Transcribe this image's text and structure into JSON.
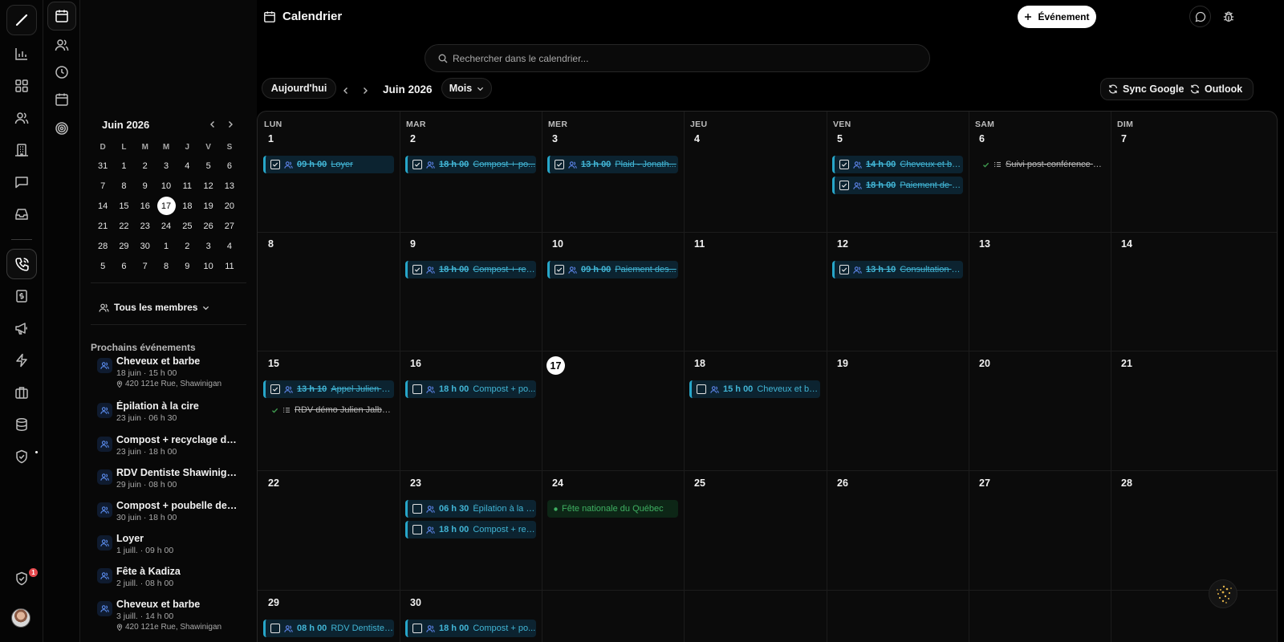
{
  "header": {
    "title": "Calendrier",
    "new_event": "Événement"
  },
  "search": {
    "placeholder": "Rechercher dans le calendrier..."
  },
  "toolbar": {
    "today": "Aujourd'hui",
    "month_label": "Juin 2026",
    "view": "Mois",
    "sync_google": "Sync Google",
    "sync_outlook": "Outlook"
  },
  "notifications": {
    "count": "1"
  },
  "mini_calendar": {
    "title": "Juin 2026",
    "dow": [
      "D",
      "L",
      "M",
      "M",
      "J",
      "V",
      "S"
    ],
    "days": [
      "31",
      "1",
      "2",
      "3",
      "4",
      "5",
      "6",
      "7",
      "8",
      "9",
      "10",
      "11",
      "12",
      "13",
      "14",
      "15",
      "16",
      "17",
      "18",
      "19",
      "20",
      "21",
      "22",
      "23",
      "24",
      "25",
      "26",
      "27",
      "28",
      "29",
      "30",
      "1",
      "2",
      "3",
      "4",
      "5",
      "6",
      "7",
      "8",
      "9",
      "10",
      "11"
    ],
    "today": "17"
  },
  "members_filter": "Tous les membres",
  "upcoming": {
    "title": "Prochains événements",
    "items": [
      {
        "title": "Cheveux et barbe",
        "when": "18 juin · 15 h 00",
        "location": "420 121e Rue, Shawinigan"
      },
      {
        "title": "Épilation à la cire",
        "when": "23 juin · 06 h 30"
      },
      {
        "title": "Compost + recyclage dem...",
        "when": "23 juin · 18 h 00"
      },
      {
        "title": "RDV Dentiste Shawinigan",
        "when": "29 juin · 08 h 00"
      },
      {
        "title": "Compost + poubelle dem...",
        "when": "30 juin · 18 h 00"
      },
      {
        "title": "Loyer",
        "when": "1 juill. · 09 h 00"
      },
      {
        "title": "Fête à Kadiza",
        "when": "2 juill. · 08 h 00"
      },
      {
        "title": "Cheveux et barbe",
        "when": "3 juill. · 14 h 00",
        "location": "420 121e Rue, Shawinigan"
      }
    ]
  },
  "weekdays": [
    "LUN",
    "MAR",
    "MER",
    "JEU",
    "VEN",
    "SAM",
    "DIM"
  ],
  "weeks": [
    [
      "1",
      "2",
      "3",
      "4",
      "5",
      "6",
      "7"
    ],
    [
      "8",
      "9",
      "10",
      "11",
      "12",
      "13",
      "14"
    ],
    [
      "15",
      "16",
      "17",
      "18",
      "19",
      "20",
      "21"
    ],
    [
      "22",
      "23",
      "24",
      "25",
      "26",
      "27",
      "28"
    ],
    [
      "29",
      "30",
      "",
      "",
      "",
      "",
      ""
    ]
  ],
  "today": "17",
  "events": [
    {
      "week": 0,
      "day": 0,
      "slot": 0,
      "kind": "done",
      "time": "09 h 00",
      "text": "Loyer"
    },
    {
      "week": 0,
      "day": 1,
      "slot": 0,
      "kind": "done",
      "time": "18 h 00",
      "text": "Compost + po..."
    },
    {
      "week": 0,
      "day": 2,
      "slot": 0,
      "kind": "done",
      "time": "13 h 00",
      "text": "Plaid - Jonath..."
    },
    {
      "week": 0,
      "day": 4,
      "slot": 0,
      "kind": "done",
      "time": "14 h 00",
      "text": "Cheveux et bar..."
    },
    {
      "week": 0,
      "day": 4,
      "slot": 1,
      "kind": "done",
      "time": "18 h 00",
      "text": "Paiement de G..."
    },
    {
      "week": 0,
      "day": 5,
      "slot": 0,
      "kind": "task",
      "time": "",
      "text": "Suivi post-conférence d..."
    },
    {
      "week": 1,
      "day": 1,
      "slot": 0,
      "kind": "done",
      "time": "18 h 00",
      "text": "Compost + rec..."
    },
    {
      "week": 1,
      "day": 2,
      "slot": 0,
      "kind": "done",
      "time": "09 h 00",
      "text": "Paiement des..."
    },
    {
      "week": 1,
      "day": 4,
      "slot": 0,
      "kind": "done",
      "time": "13 h 10",
      "text": "Consultation St..."
    },
    {
      "week": 2,
      "day": 0,
      "slot": 0,
      "kind": "done",
      "time": "13 h 10",
      "text": "Appel Julien Jal..."
    },
    {
      "week": 2,
      "day": 0,
      "slot": 1,
      "kind": "task",
      "time": "",
      "text": "RDV démo Julien Jalber..."
    },
    {
      "week": 2,
      "day": 1,
      "slot": 0,
      "kind": "open",
      "time": "18 h 00",
      "text": "Compost + po..."
    },
    {
      "week": 2,
      "day": 3,
      "slot": 0,
      "kind": "open",
      "time": "15 h 00",
      "text": "Cheveux et bar..."
    },
    {
      "week": 3,
      "day": 1,
      "slot": 0,
      "kind": "open",
      "time": "06 h 30",
      "text": "Épilation à la ci..."
    },
    {
      "week": 3,
      "day": 1,
      "slot": 1,
      "kind": "open",
      "time": "18 h 00",
      "text": "Compost + rec..."
    },
    {
      "week": 3,
      "day": 2,
      "slot": 0,
      "kind": "holiday",
      "time": "",
      "text": "Fête nationale du Québec"
    },
    {
      "week": 4,
      "day": 0,
      "slot": 0,
      "kind": "open",
      "time": "08 h 00",
      "text": "RDV Dentiste S..."
    },
    {
      "week": 4,
      "day": 1,
      "slot": 0,
      "kind": "open",
      "time": "18 h 00",
      "text": "Compost + po..."
    }
  ],
  "colors": {
    "accent": "#27a6c9",
    "holiday": "#3fb062",
    "people_icon": "#5c84e8",
    "badge": "#e5484d"
  }
}
